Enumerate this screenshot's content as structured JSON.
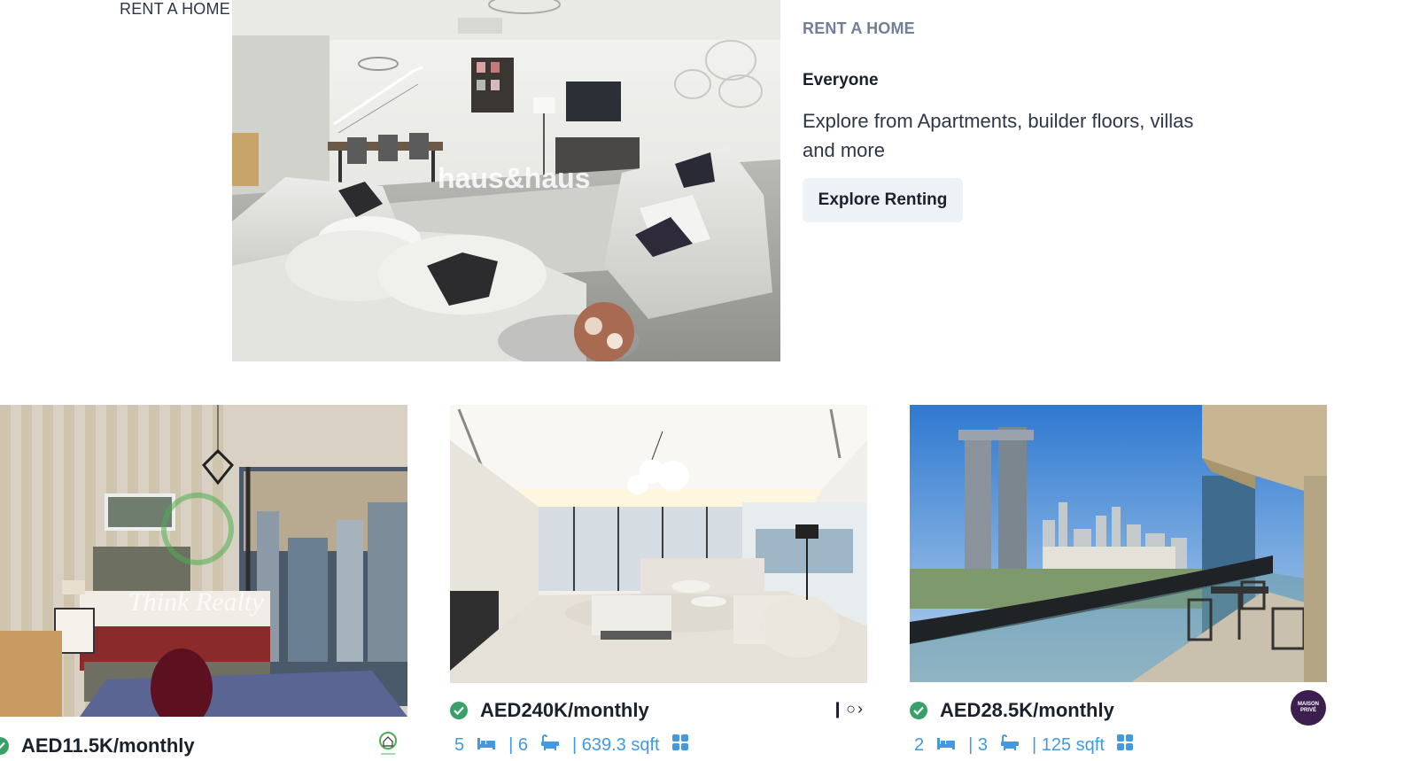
{
  "hero": {
    "overflow_label": "RENT A HOME",
    "eyebrow": "RENT A HOME",
    "title": "Everyone",
    "description": "Explore from Apartments, builder floors, villas and more",
    "cta_label": "Explore Renting",
    "watermark": "haus&haus"
  },
  "listings": [
    {
      "price": "AED11.5K/monthly",
      "agency_watermark": "Think Realty"
    },
    {
      "price": "AED240K/monthly",
      "beds": "5",
      "baths": "| 6",
      "area": "| 639.3 sqft",
      "nav": "❙○›"
    },
    {
      "price": "AED28.5K/monthly",
      "beds": "2",
      "baths": "| 3",
      "area": "| 125 sqft",
      "agency_logo_text": "MAISON PRIVÉ"
    }
  ],
  "colors": {
    "accent_blue": "#4299e1",
    "verified_green": "#38a169",
    "button_bg": "#edf2f7",
    "muted_text": "#718096"
  },
  "icons": [
    "check-circle-icon",
    "bed-icon",
    "bath-icon",
    "grid-icon",
    "carousel-arrows-icon"
  ]
}
